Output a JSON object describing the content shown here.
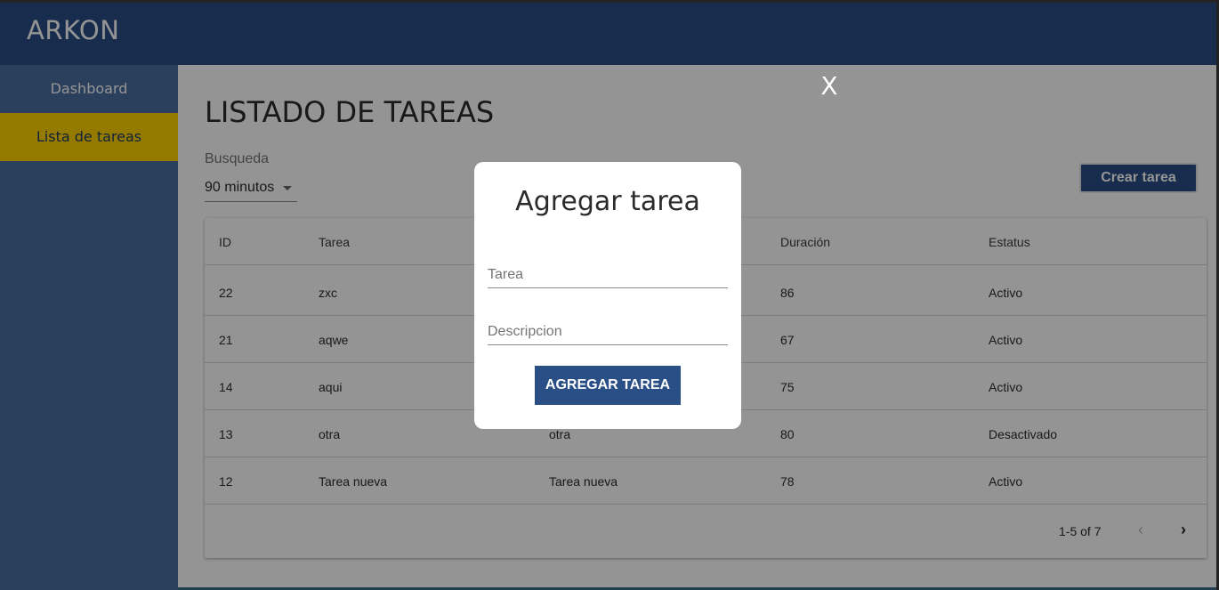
{
  "header": {
    "brand": "ARKON"
  },
  "sidebar": {
    "items": [
      {
        "label": "Dashboard",
        "active": false
      },
      {
        "label": "Lista de tareas",
        "active": true
      }
    ]
  },
  "main": {
    "title": "LISTADO DE TAREAS",
    "search": {
      "label": "Busqueda",
      "selected": "90 minutos"
    },
    "create_button": "Crear tarea",
    "table": {
      "headers": [
        "ID",
        "Tarea",
        "",
        "Duración",
        "Estatus"
      ],
      "rows": [
        [
          "22",
          "zxc",
          "",
          "86",
          "Activo"
        ],
        [
          "21",
          "aqwe",
          "",
          "67",
          "Activo"
        ],
        [
          "14",
          "aqui",
          "",
          "75",
          "Activo"
        ],
        [
          "13",
          "otra",
          "otra",
          "80",
          "Desactivado"
        ],
        [
          "12",
          "Tarea nueva",
          "Tarea nueva",
          "78",
          "Activo"
        ]
      ]
    },
    "pagination": {
      "range": "1-5 of 7"
    }
  },
  "modal": {
    "close_glyph": "X",
    "title": "Agregar tarea",
    "fields": {
      "tarea_placeholder": "Tarea",
      "descripcion_placeholder": "Descripcion"
    },
    "submit": "AGREGAR TAREA"
  },
  "colors": {
    "primary": "#2a4f86",
    "sidebar": "#4a6fa0",
    "active": "#ffd500"
  }
}
